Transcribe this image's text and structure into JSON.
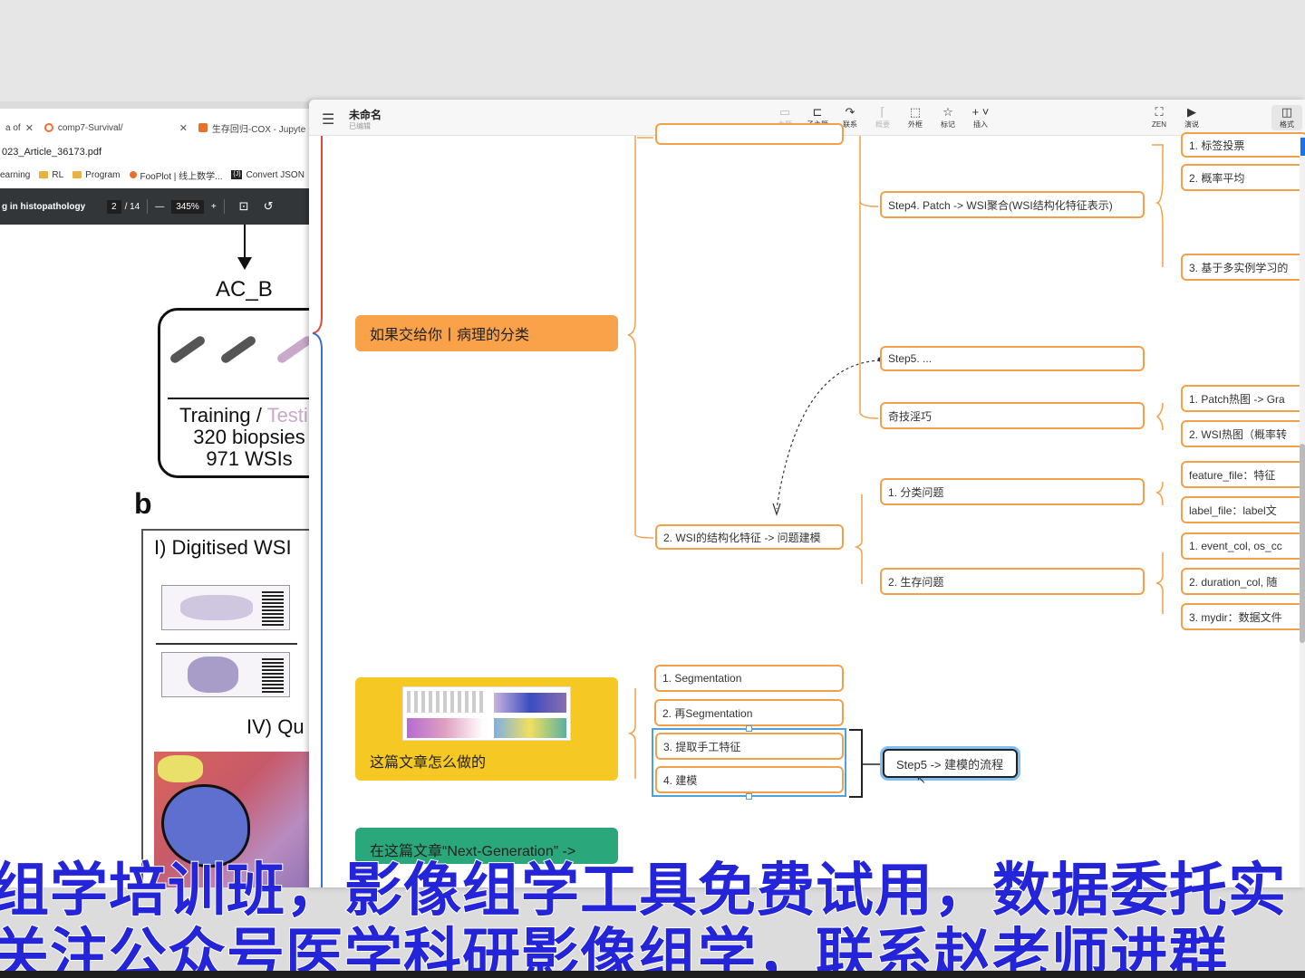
{
  "browser": {
    "tabs": [
      {
        "label": "a of",
        "closable": true
      },
      {
        "label": "comp7-Survival/",
        "closable": true
      },
      {
        "label": "生存回归-COX - Jupyte",
        "closable": false
      }
    ],
    "url": "023_Article_36173.pdf",
    "bookmarks": [
      "earning",
      "RL",
      "Program",
      "FooPlot | 线上数学...",
      "Convert JSON"
    ],
    "bookmark_badge": "{J}",
    "pdf": {
      "title": "g in histopathology",
      "page_current": "2",
      "page_total": "/ 14",
      "zoom": "345%",
      "zoom_out": "—",
      "zoom_in": "+",
      "figure": {
        "ac_label": "AC_B",
        "training_label": "Training / ",
        "testing_label": "Testin",
        "biopsies": "320 biopsies",
        "wsis": "971 WSIs",
        "panel_b": "b",
        "digitised": "I) Digitised WSI",
        "quant": "IV) Qu"
      }
    }
  },
  "mindmap": {
    "title": "未命名",
    "subtitle": "已编辑",
    "toolbar": [
      {
        "label": "主题",
        "glyph": "▭",
        "dim": true
      },
      {
        "label": "子主题",
        "glyph": "⊏",
        "dim": false
      },
      {
        "label": "联系",
        "glyph": "↷",
        "dim": false
      },
      {
        "label": "概要",
        "glyph": "⌈",
        "dim": true
      },
      {
        "label": "外框",
        "glyph": "⬚",
        "dim": false
      },
      {
        "label": "标记",
        "glyph": "☆",
        "dim": false
      },
      {
        "label": "插入",
        "glyph": "+ ˅",
        "dim": false
      }
    ],
    "toolbar_right": [
      {
        "label": "ZEN",
        "glyph": "⛶"
      },
      {
        "label": "演说",
        "glyph": "▶"
      },
      {
        "label": "格式",
        "glyph": "◫"
      }
    ],
    "topics": {
      "classification": "如果交给你丨病理的分类",
      "howdone": "这篇文章怎么做的",
      "nextgen": "在这篇文章“Next-Generation” ->"
    },
    "nodes": {
      "step4": "Step4. Patch -> WSI聚合(WSI结构化特征表示)",
      "step5": "Step5. ...",
      "tricks": "奇技淫巧",
      "wsi_feature": "2. WSI的结构化特征 -> 问题建模",
      "cls_problem": "1. 分类问题",
      "surv_problem": "2. 生存问题",
      "vote": "1. 标签投票",
      "avgprob": "2. 概率平均",
      "mil": "3. 基于多实例学习的",
      "patch_heat": "1. Patch热图 -> Gra",
      "wsi_heat": "2. WSI热图（概率转",
      "feature_file": "feature_file：特征",
      "label_file": "label_file：label文",
      "event_col": "1. event_col, os_cc",
      "duration_col": "2. duration_col, 随",
      "mydir": "3. mydir：数据文件",
      "seg1": "1. Segmentation",
      "seg2": "2. 再Segmentation",
      "handcraft": "3. 提取手工特征",
      "modeling": "4. 建模",
      "step5_flow": "Step5 -> 建模的流程"
    },
    "colors": {
      "orange_topic": "#f9a24a",
      "yellow_topic": "#f5c823",
      "green_topic": "#2aa77b",
      "orange_branch": "#f3a04a",
      "red_branch": "#e04a3a",
      "blue_branch": "#3b6fd0",
      "selection": "#4aa3e0"
    }
  },
  "subtitles": {
    "line1": "组学培训班，影像组学工具免费试用，数据委托实",
    "line2": "关注公众号医学科研影像组学，联系赵老师进群"
  }
}
